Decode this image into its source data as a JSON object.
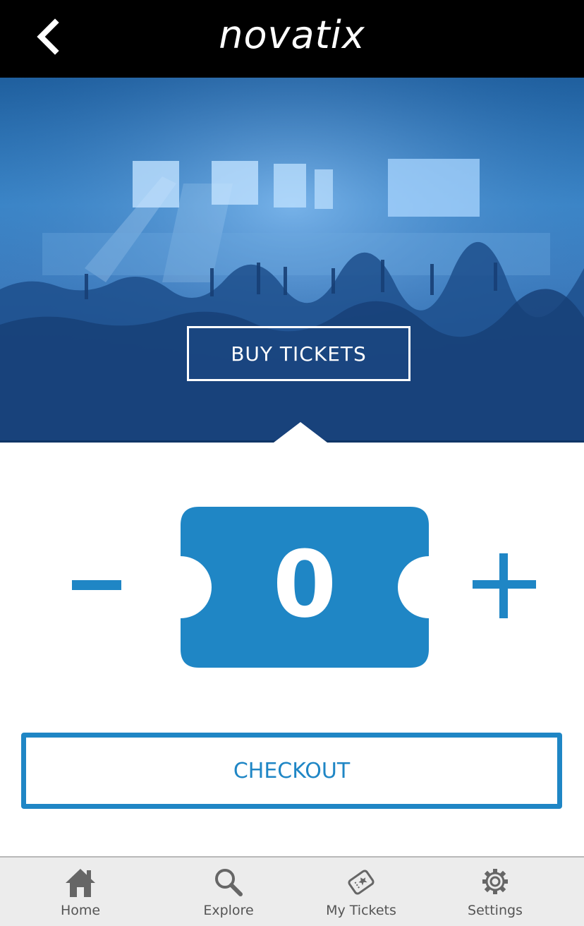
{
  "app": {
    "title": "novatix"
  },
  "header": {
    "back_icon": "chevron-left-icon"
  },
  "hero": {
    "button_label": "BUY TICKETS"
  },
  "stepper": {
    "decrement_icon": "minus-icon",
    "increment_icon": "plus-icon",
    "count": "0"
  },
  "checkout": {
    "label": "CHECKOUT"
  },
  "nav": {
    "items": [
      {
        "label": "Home",
        "icon": "home-icon"
      },
      {
        "label": "Explore",
        "icon": "search-icon"
      },
      {
        "label": "My Tickets",
        "icon": "ticket-tag-icon"
      },
      {
        "label": "Settings",
        "icon": "gear-icon"
      }
    ]
  },
  "colors": {
    "accent": "#1f86c5",
    "header": "#000000",
    "nav_bg": "#ececec"
  }
}
